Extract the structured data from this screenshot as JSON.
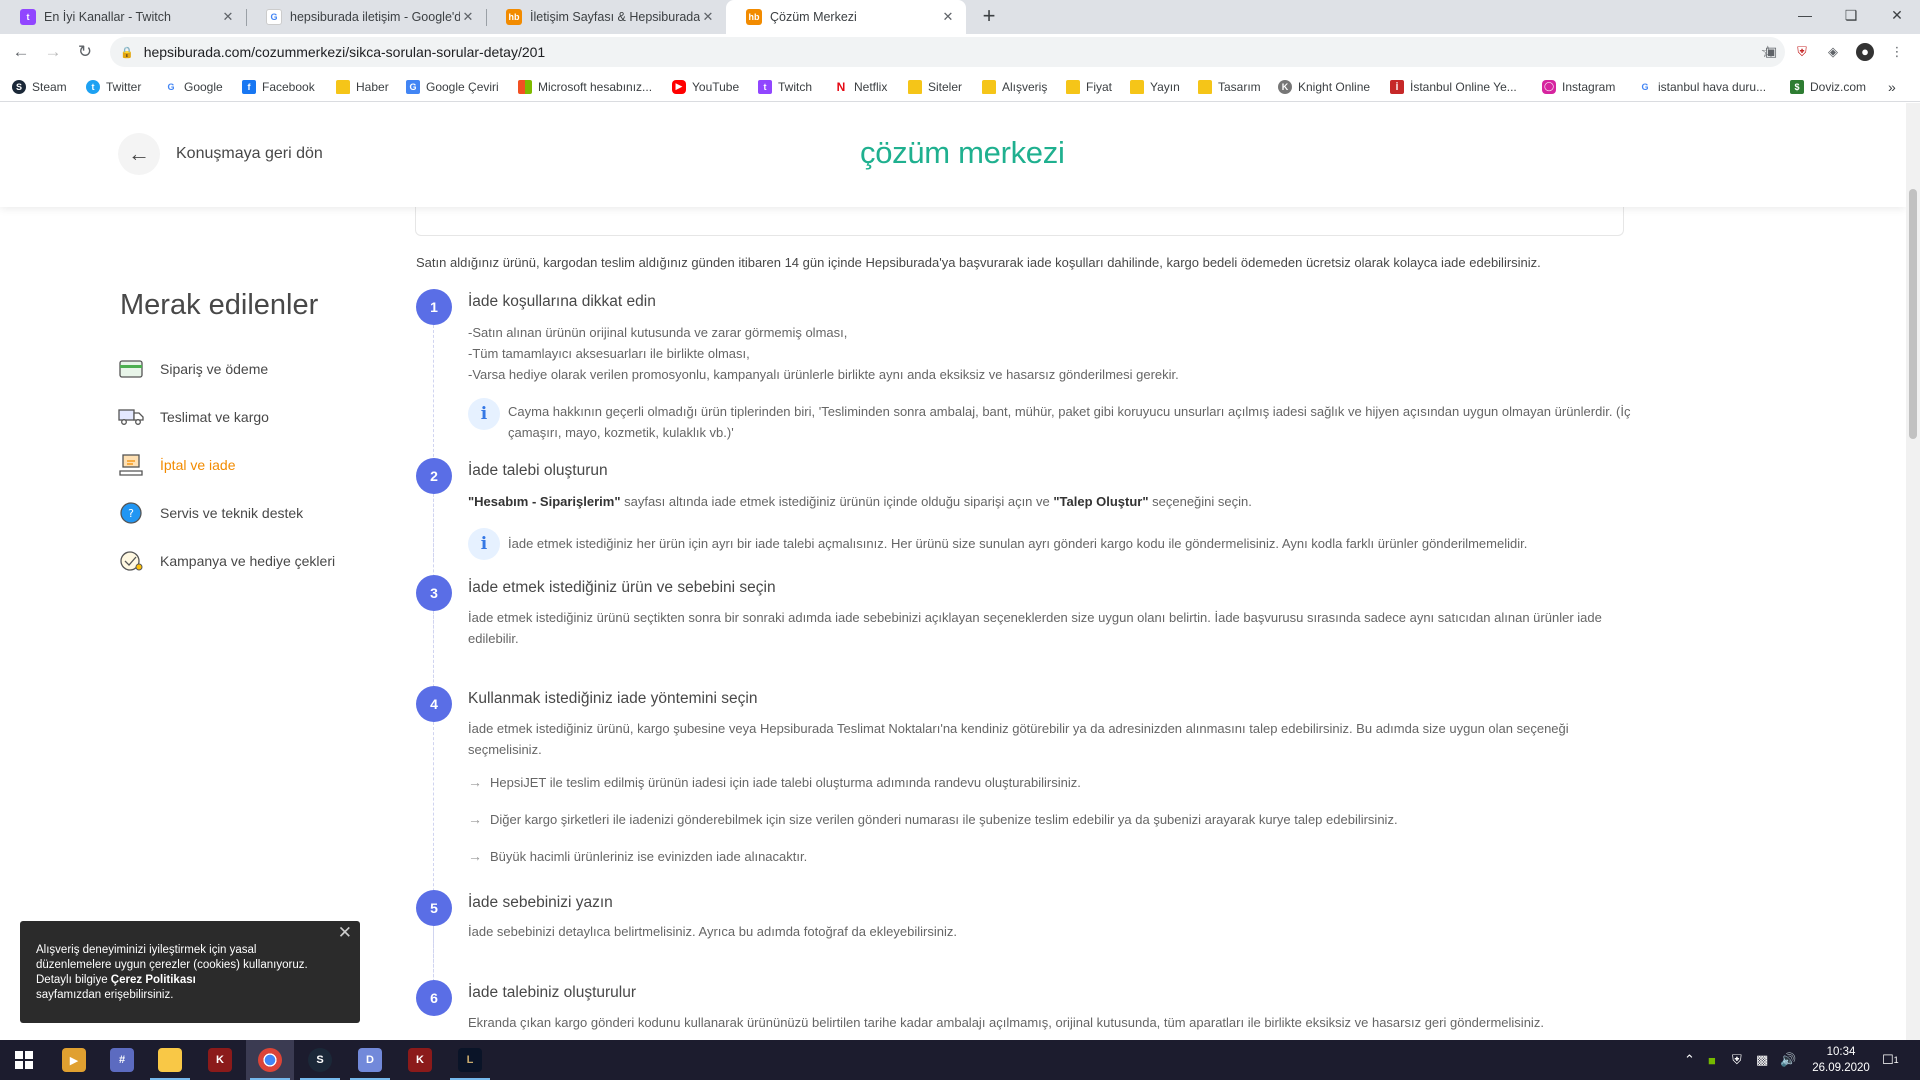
{
  "browser": {
    "tabs": [
      {
        "title": "En İyi Kanallar - Twitch",
        "icon": "twitch-icon"
      },
      {
        "title": "hepsiburada iletişim - Google'da Ara",
        "icon": "google-icon"
      },
      {
        "title": "İletişim Sayfası & Hepsiburada.com",
        "icon": "hepsiburada-icon"
      },
      {
        "title": "Çözüm Merkezi",
        "icon": "hepsiburada-icon"
      }
    ],
    "new_tab": "+",
    "url": "hepsiburada.com/cozummerkezi/sikca-sorulan-sorular-detay/201",
    "bookmarks": [
      {
        "label": "Steam",
        "icon": "steam-icon"
      },
      {
        "label": "Twitter",
        "icon": "twitter-icon"
      },
      {
        "label": "Google",
        "icon": "google-icon"
      },
      {
        "label": "Facebook",
        "icon": "facebook-icon"
      },
      {
        "label": "Haber",
        "icon": "folder-icon"
      },
      {
        "label": "Google Çeviri",
        "icon": "translate-icon"
      },
      {
        "label": "Microsoft hesabınız...",
        "icon": "microsoft-icon"
      },
      {
        "label": "YouTube",
        "icon": "youtube-icon"
      },
      {
        "label": "Twitch",
        "icon": "twitch-icon"
      },
      {
        "label": "Netflix",
        "icon": "netflix-icon"
      },
      {
        "label": "Siteler",
        "icon": "folder-icon"
      },
      {
        "label": "Alışveriş",
        "icon": "folder-icon"
      },
      {
        "label": "Fiyat",
        "icon": "folder-icon"
      },
      {
        "label": "Yayın",
        "icon": "folder-icon"
      },
      {
        "label": "Tasarım",
        "icon": "folder-icon"
      },
      {
        "label": "Knight Online",
        "icon": "knight-online-icon"
      },
      {
        "label": "İstanbul Online Ye...",
        "icon": "istanbul-icon"
      },
      {
        "label": "Instagram",
        "icon": "instagram-icon"
      },
      {
        "label": "istanbul hava duru...",
        "icon": "google-icon"
      },
      {
        "label": "Doviz.com",
        "icon": "doviz-icon"
      }
    ],
    "bookmarks_overflow": "»"
  },
  "header": {
    "back_label": "Konuşmaya geri dön",
    "logo": "çözüm merkezi"
  },
  "sidebar": {
    "title": "Merak edilenler",
    "items": [
      {
        "label": "Sipariş ve ödeme",
        "icon": "credit-card-icon",
        "active": false
      },
      {
        "label": "Teslimat ve kargo",
        "icon": "delivery-truck-icon",
        "active": false
      },
      {
        "label": "İptal ve iade",
        "icon": "return-box-icon",
        "active": true
      },
      {
        "label": "Servis ve teknik destek",
        "icon": "support-icon",
        "active": false
      },
      {
        "label": "Kampanya ve hediye çekleri",
        "icon": "gift-voucher-icon",
        "active": false
      }
    ]
  },
  "content": {
    "intro": "Satın aldığınız ürünü, kargodan teslim aldığınız günden itibaren 14 gün içinde Hepsiburada'ya başvurarak iade koşulları dahilinde, kargo bedeli ödemeden ücretsiz olarak kolayca iade edebilirsiniz.",
    "steps": [
      {
        "num": "1",
        "title": "İade koşullarına dikkat edin",
        "lines": [
          "-Satın alınan ürünün orijinal kutusunda ve zarar görmemiş olması,",
          "-Tüm tamamlayıcı aksesuarları ile birlikte olması,",
          "-Varsa hediye olarak verilen promosyonlu, kampanyalı ürünlerle birlikte aynı anda eksiksiz ve hasarsız gönderilmesi gerekir."
        ],
        "info": "Cayma hakkının geçerli olmadığı ürün tiplerinden biri, 'Tesliminden sonra ambalaj, bant, mühür, paket gibi koruyucu unsurları açılmış iadesi sağlık ve hijyen açısından uygun olmayan ürünlerdir. (İç çamaşırı, mayo, kozmetik, kulaklık vb.)'"
      },
      {
        "num": "2",
        "title": "İade talebi oluşturun",
        "text_bold1": "\"Hesabım - Siparişlerim\"",
        "text_mid": " sayfası altında iade etmek istediğiniz ürünün içinde olduğu siparişi açın ve ",
        "text_bold2": "\"Talep Oluştur\"",
        "text_end": " seçeneğini seçin.",
        "info": "İade etmek istediğiniz her ürün için ayrı bir iade talebi açmalısınız. Her ürünü size sunulan ayrı gönderi kargo kodu ile göndermelisiniz. Aynı kodla farklı ürünler gönderilmemelidir."
      },
      {
        "num": "3",
        "title": "İade etmek istediğiniz ürün ve sebebini seçin",
        "text": "İade etmek istediğiniz ürünü seçtikten sonra bir sonraki adımda iade sebebinizi açıklayan seçeneklerden size uygun olanı belirtin. İade başvurusu sırasında sadece aynı satıcıdan alınan ürünler iade edilebilir."
      },
      {
        "num": "4",
        "title": "Kullanmak istediğiniz iade yöntemini seçin",
        "text": "İade etmek istediğiniz ürünü, kargo şubesine veya Hepsiburada Teslimat Noktaları'na kendiniz götürebilir ya da adresinizden alınmasını talep edebilirsiniz. Bu adımda size uygun olan seçeneği seçmelisiniz.",
        "bullets": [
          "HepsiJET ile teslim edilmiş ürünün iadesi için iade talebi oluşturma adımında randevu oluşturabilirsiniz.",
          "Diğer kargo şirketleri ile iadenizi gönderebilmek için size verilen gönderi numarası ile şubenize teslim edebilir ya da şubenizi arayarak kurye talep edebilirsiniz.",
          "Büyük hacimli ürünleriniz ise evinizden iade alınacaktır."
        ]
      },
      {
        "num": "5",
        "title": "İade sebebinizi yazın",
        "text": "İade sebebinizi detaylıca belirtmelisiniz. Ayrıca bu adımda fotoğraf da ekleyebilirsiniz."
      },
      {
        "num": "6",
        "title": "İade talebiniz oluşturulur",
        "text": "Ekranda çıkan kargo gönderi kodunu kullanarak ürününüzü belirtilen tarihe kadar ambalajı açılmamış, orijinal kutusunda, tüm aparatları ile birlikte eksiksiz ve hasarsız geri göndermelisiniz."
      }
    ]
  },
  "cookie": {
    "line1": "Alışveriş deneyiminizi iyileştirmek için yasal",
    "line2": "düzenlemelere uygun çerezler (cookies) kullanıyoruz.",
    "line3a": "Detaylı bilgiye ",
    "line3b": "Çerez Politikası",
    "line4": "sayfamızdan erişebilirsiniz."
  },
  "taskbar": {
    "clock_time": "10:34",
    "clock_date": "26.09.2020",
    "notification_count": "1"
  },
  "colors": {
    "brand": "#1fb08f",
    "active": "#f28b00",
    "step": "#5a6ee6"
  }
}
